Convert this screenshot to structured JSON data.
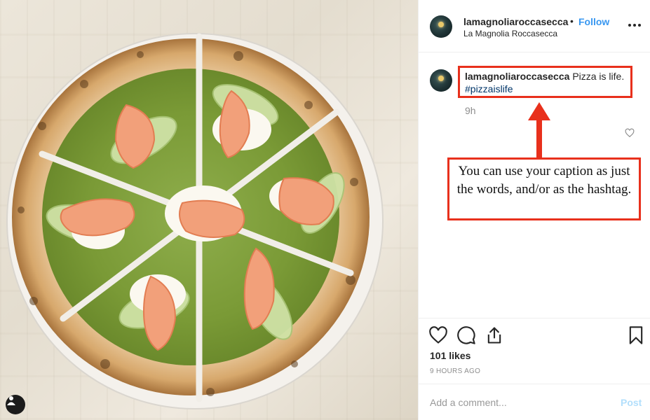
{
  "post": {
    "username": "lamagnoliaroccasecca",
    "separator": "•",
    "follow_label": "Follow",
    "location": "La Magnolia Roccasecca",
    "more_icon": "more-horizontal-icon"
  },
  "caption": {
    "username": "lamagnoliaroccasecca",
    "text": "Pizza is life.",
    "hashtag": "#pizzaislife",
    "time": "9h",
    "like_icon": "heart-outline-icon"
  },
  "annotation": {
    "note": "You can use your caption as just the words, and/or as the hashtag.",
    "color": "#e8301c"
  },
  "actions": {
    "icons": [
      "heart-icon",
      "comment-icon",
      "share-icon",
      "bookmark-icon"
    ],
    "likes": "101 likes",
    "time_ago": "9 HOURS AGO"
  },
  "comment_box": {
    "placeholder": "Add a comment...",
    "post_label": "Post"
  },
  "colors": {
    "link_blue": "#3897f0",
    "hashtag_blue": "#003569",
    "muted": "#8e8e8e",
    "post_disabled": "#b2dffc"
  }
}
